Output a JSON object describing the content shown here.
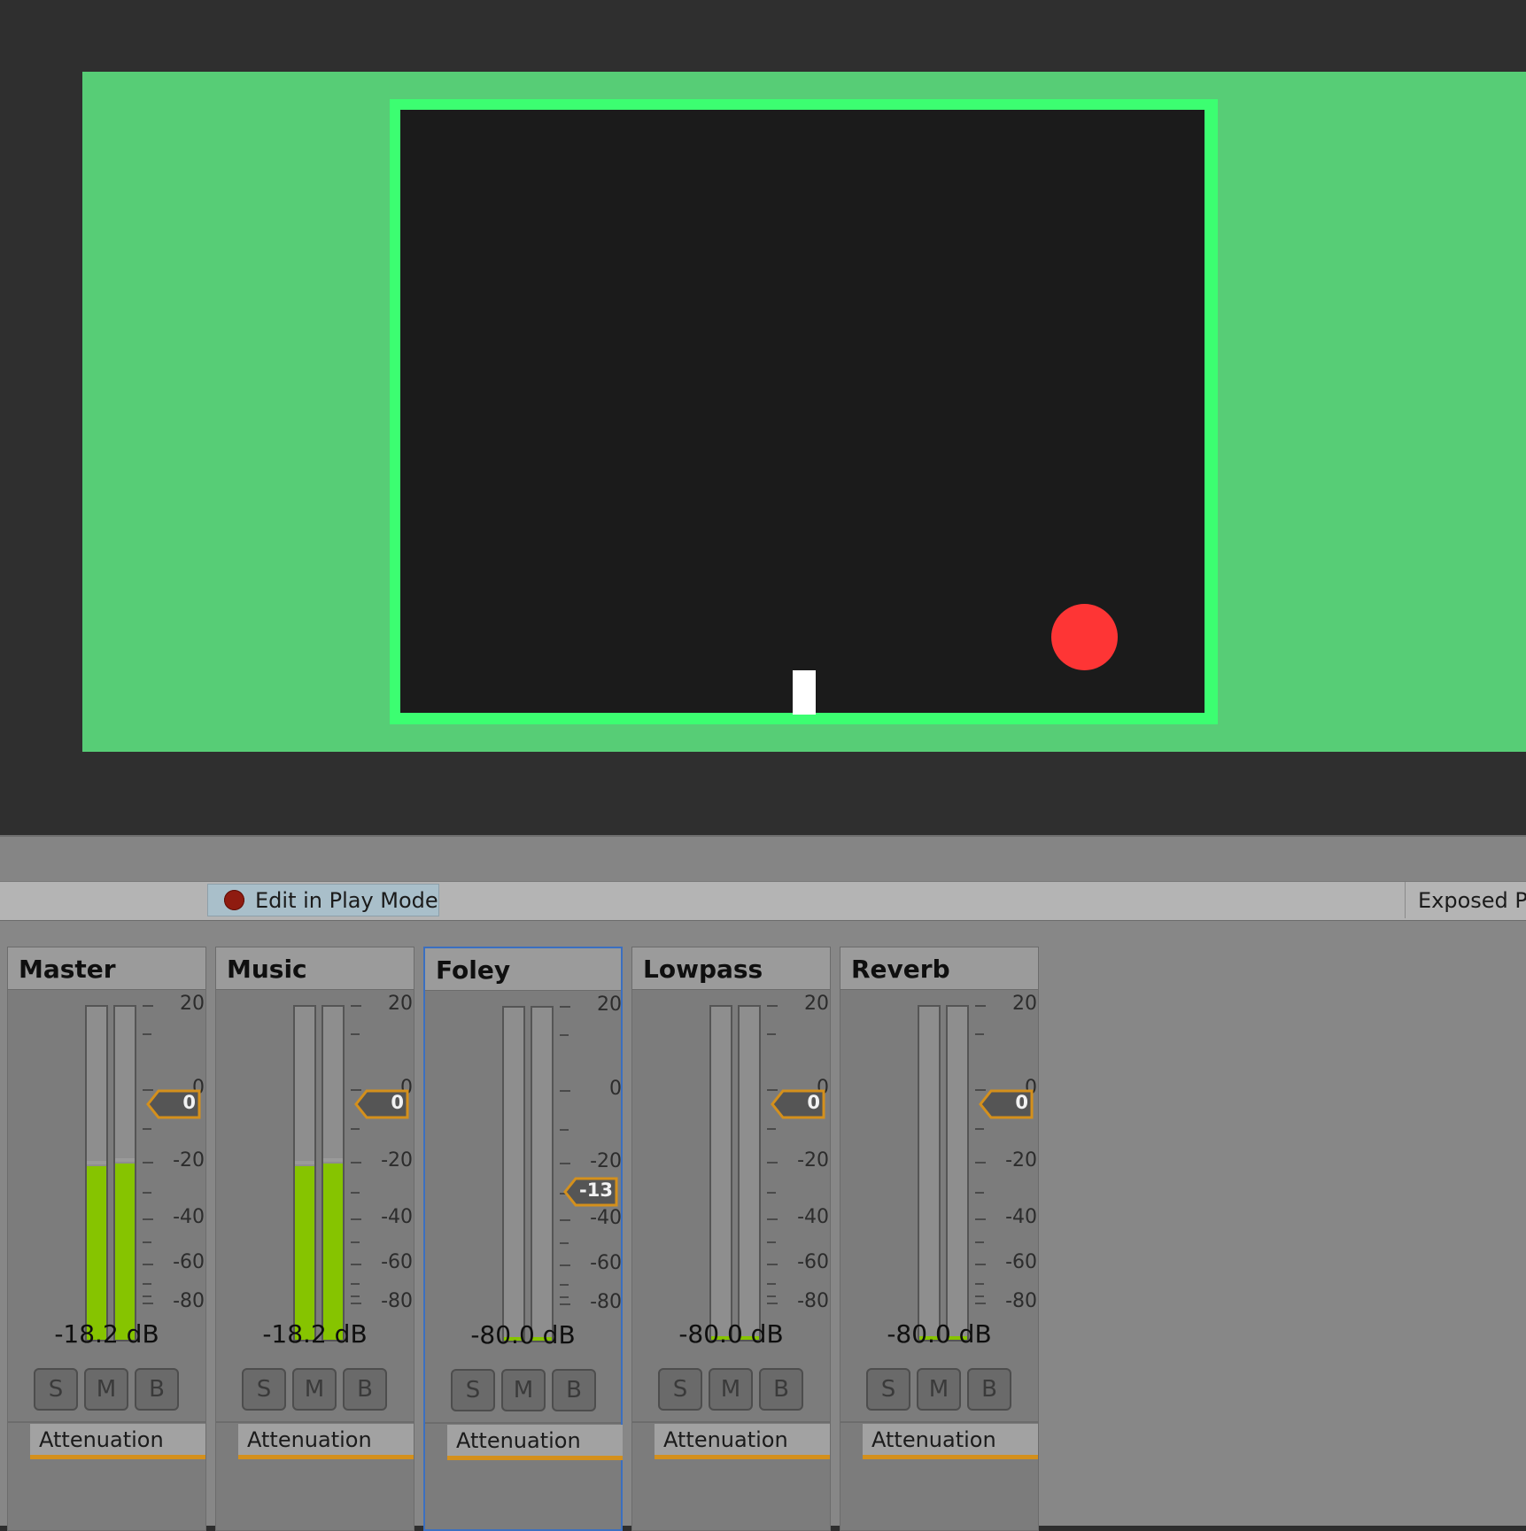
{
  "toolbar": {
    "edit_in_play_mode": "Edit in Play Mode",
    "exposed_parameters": "Exposed Pa"
  },
  "game": {
    "colors": {
      "background": "#2f2f2f",
      "play_area": "#57cd76",
      "arena_border": "#3cfe71",
      "arena": "#1b1b1b",
      "ball": "#fe3535",
      "paddle": "#ffffff"
    }
  },
  "mixer": {
    "scale_labels": [
      "20",
      "0",
      "-20",
      "-40",
      "-60",
      "-80"
    ],
    "groups": [
      {
        "name": "Master",
        "db": "-18.2 dB",
        "fader_value": "0",
        "meter_left": 0.52,
        "meter_right": 0.53,
        "selected": false,
        "buttons": [
          "S",
          "M",
          "B"
        ],
        "effect": "Attenuation"
      },
      {
        "name": "Music",
        "db": "-18.2 dB",
        "fader_value": "0",
        "meter_left": 0.52,
        "meter_right": 0.53,
        "selected": false,
        "buttons": [
          "S",
          "M",
          "B"
        ],
        "effect": "Attenuation"
      },
      {
        "name": "Foley",
        "db": "-80.0 dB",
        "fader_value": "-13",
        "meter_left": 0.0,
        "meter_right": 0.0,
        "selected": true,
        "buttons": [
          "S",
          "M",
          "B"
        ],
        "effect": "Attenuation"
      },
      {
        "name": "Lowpass",
        "db": "-80.0 dB",
        "fader_value": "0",
        "meter_left": 0.0,
        "meter_right": 0.0,
        "selected": false,
        "buttons": [
          "S",
          "M",
          "B"
        ],
        "effect": "Attenuation"
      },
      {
        "name": "Reverb",
        "db": "-80.0 dB",
        "fader_value": "0",
        "meter_left": 0.0,
        "meter_right": 0.0,
        "selected": false,
        "buttons": [
          "S",
          "M",
          "B"
        ],
        "effect": "Attenuation"
      }
    ]
  }
}
